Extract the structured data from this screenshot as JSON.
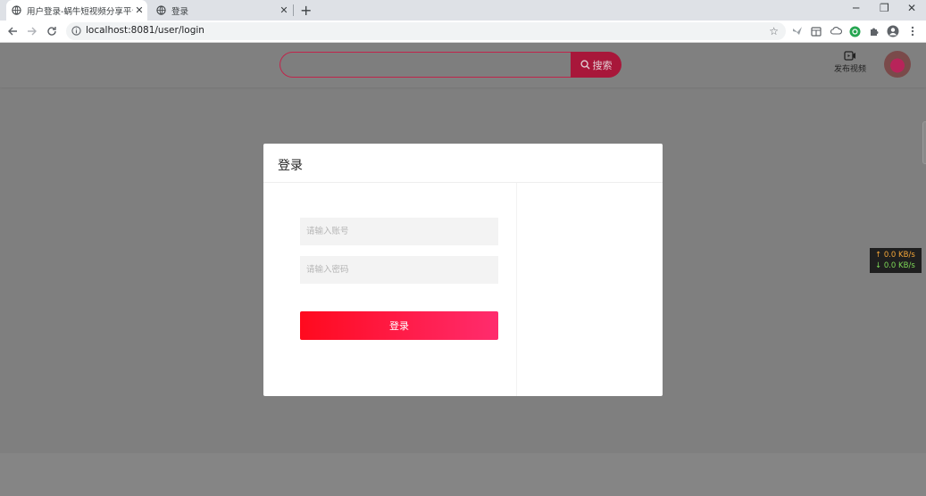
{
  "browser": {
    "tabs": [
      {
        "title": "用户登录-蜗牛短视频分享平台",
        "close": "✕",
        "icon": "globe-icon"
      },
      {
        "title": "登录",
        "close": "✕",
        "icon": "globe-icon"
      }
    ],
    "new_tab": "+",
    "window_controls": {
      "minimize": "─",
      "restore": "❐",
      "close": "✕"
    },
    "url": "localhost:8081/user/login"
  },
  "header": {
    "search": {
      "placeholder": "",
      "button_label": "搜索",
      "accent": "#c0254b"
    },
    "publish_label": "发布视频"
  },
  "speed_widget": {
    "up": "↑ 0.0 KB/s",
    "down": "↓ 0.0 KB/s"
  },
  "modal": {
    "title": "登录",
    "account_placeholder": "请输入账号",
    "password_placeholder": "请输入密码",
    "submit_label": "登录",
    "button_gradient": [
      "#ff0a1e",
      "#ff2c6e"
    ]
  }
}
